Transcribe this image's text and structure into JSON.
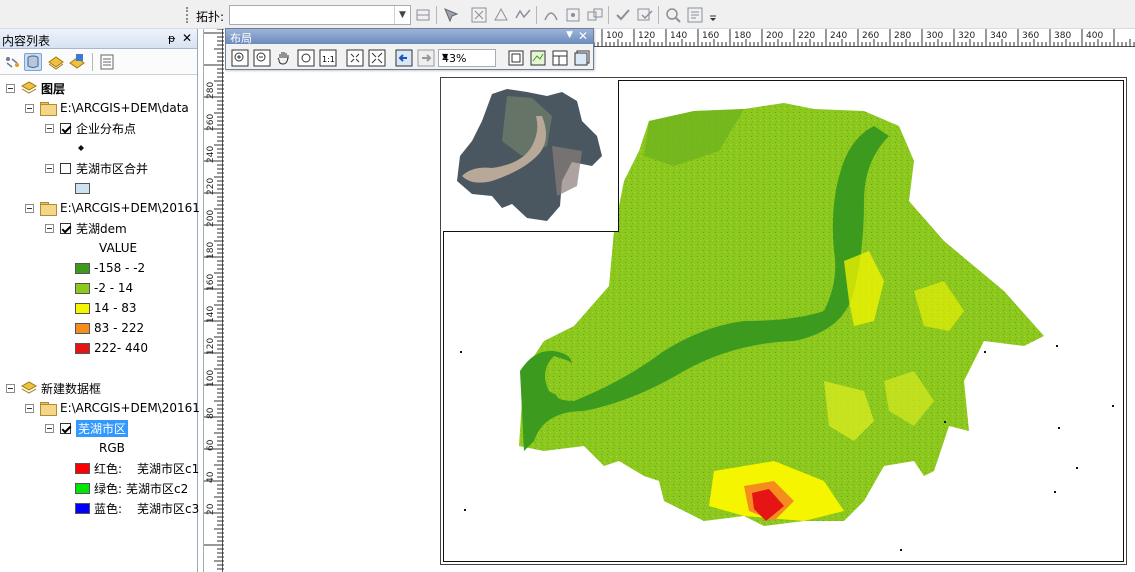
{
  "topology_toolbar": {
    "label": "拓扑:",
    "selected_topology": ""
  },
  "toc": {
    "title": "内容列表",
    "pin": "ᵽ",
    "close": "✕",
    "data_frames": [
      {
        "name": "图层",
        "groups": [
          {
            "path": "E:\\ARCGIS+DEM\\data",
            "layers": [
              {
                "name": "企业分布点",
                "checked": true,
                "symbol": "point"
              },
              {
                "name": "芜湖市区合并",
                "checked": false,
                "symbol": "polygon",
                "color": "#cde3f2"
              }
            ]
          },
          {
            "path": "E:\\ARCGIS+DEM\\20161",
            "layers": [
              {
                "name": "芜湖dem",
                "checked": true,
                "legend_title": "VALUE",
                "classes": [
                  {
                    "label": "-158 - -2",
                    "color": "#3c9b1e"
                  },
                  {
                    "label": "-2 - 14",
                    "color": "#8cc81e"
                  },
                  {
                    "label": "14 - 83",
                    "color": "#f5f500"
                  },
                  {
                    "label": "83 - 222",
                    "color": "#f58c1e"
                  },
                  {
                    "label": "222- 440",
                    "color": "#e61414"
                  }
                ]
              }
            ]
          }
        ]
      },
      {
        "name": "新建数据框",
        "groups": [
          {
            "path": "E:\\ARCGIS+DEM\\20161",
            "layers": [
              {
                "name": "芜湖市区",
                "checked": true,
                "selected": true,
                "legend_title": "RGB",
                "bands": [
                  {
                    "band": "红色:",
                    "value": "芜湖市区c1",
                    "color": "#ff0000"
                  },
                  {
                    "band": "绿色:",
                    "value": "芜湖市区c2",
                    "color": "#00e600"
                  },
                  {
                    "band": "蓝色:",
                    "value": "芜湖市区c3",
                    "color": "#0000ff"
                  }
                ]
              }
            ]
          }
        ]
      }
    ]
  },
  "layout_toolbar": {
    "title": "布局",
    "zoom": "43%"
  },
  "rulers": {
    "horizontal": [
      "100",
      "120",
      "140",
      "160",
      "180",
      "200",
      "220",
      "240",
      "260",
      "280",
      "300",
      "320",
      "340",
      "360",
      "380",
      "400"
    ],
    "vertical": [
      "280",
      "260",
      "240",
      "220",
      "200",
      "180",
      "160",
      "140",
      "120",
      "100",
      "80",
      "60",
      "40",
      "20"
    ]
  }
}
